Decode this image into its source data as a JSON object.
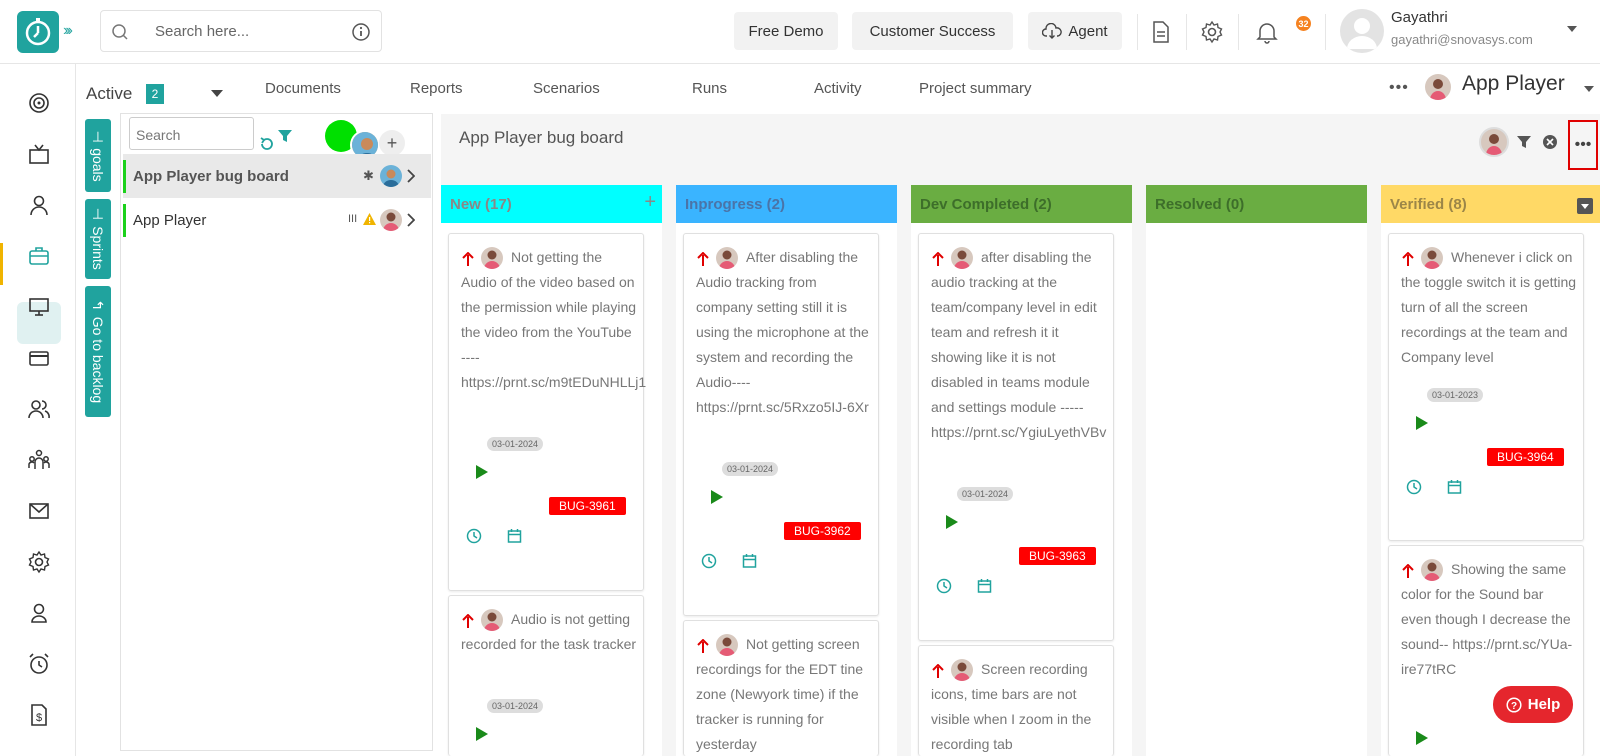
{
  "topbar": {
    "search_placeholder": "Search here...",
    "buttons": {
      "free_demo": "Free Demo",
      "customer_success": "Customer Success",
      "agent": "Agent"
    },
    "notification_count": "32",
    "user": {
      "name": "Gayathri",
      "email": "gayathri@snovasys.com"
    }
  },
  "subnav": {
    "active_label": "Active",
    "active_count": "2",
    "tabs": [
      "Documents",
      "Reports",
      "Scenarios",
      "Runs",
      "Activity",
      "Project summary"
    ],
    "project_name": "App Player"
  },
  "vertical_tabs": {
    "goals": "goals",
    "sprints": "Sprints",
    "backlog": "Go to backlog"
  },
  "list_panel": {
    "search_placeholder": "Search",
    "items": [
      {
        "label": "App Player bug board"
      },
      {
        "label": "App Player"
      }
    ]
  },
  "board": {
    "title": "App Player bug board",
    "columns": [
      {
        "title": "New (17)",
        "color": "#00ffff"
      },
      {
        "title": "Inprogress (2)",
        "color": "#3ab4ff"
      },
      {
        "title": "Dev Completed (2)",
        "color": "#6aad42"
      },
      {
        "title": "Resolved (0)",
        "color": "#6aad42"
      },
      {
        "title": "Verified (8)",
        "color": "#ffd966"
      }
    ],
    "cards": {
      "c1": {
        "lead": "Not getting the",
        "rest": "Audio of the video based on the permission while playing the video from the YouTube ---- https://prnt.sc/m9tEDuNHLLj1",
        "date": "03-01-2024",
        "tag": "BUG-3961"
      },
      "c2": {
        "lead": "Audio is not",
        "rest": "getting recorded for the task tracker",
        "date": "03-01-2024"
      },
      "c3": {
        "lead": "After disabling the",
        "rest": "Audio tracking from company setting still it is using the microphone at the system and recording the Audio---- https://prnt.sc/5Rxzo5IJ-6Xr",
        "date": "03-01-2024",
        "tag": "BUG-3962"
      },
      "c4": {
        "lead": "Not getting screen",
        "rest": "recordings for the EDT tine zone (Newyork time) if the tracker is running for yesterday"
      },
      "c5": {
        "lead": "after disabling the",
        "rest": "audio tracking at the team/company level in edit team and refresh it it showing like it is not disabled in teams module and settings module ----- https://prnt.sc/YgiuLyethVBv",
        "date": "03-01-2024",
        "tag": "BUG-3963"
      },
      "c6": {
        "lead": "Screen recording",
        "rest": "icons, time bars are not visible when I zoom in the recording tab"
      },
      "c7": {
        "lead": "Whenever i click",
        "rest": "on the toggle switch it is getting turn of all the screen recordings at the team and Company level",
        "date": "03-01-2023",
        "tag": "BUG-3964"
      },
      "c8": {
        "lead": "Showing the same",
        "rest": "color for the Sound bar even though I decrease the sound-- https://prnt.sc/YUa-ire77tRC"
      }
    }
  },
  "help_label": "Help",
  "colors": {
    "teal": "#20a39e",
    "priority_arrow": "#e00000",
    "play": "#1a8a1a",
    "bug_tag": "#ff0000"
  }
}
